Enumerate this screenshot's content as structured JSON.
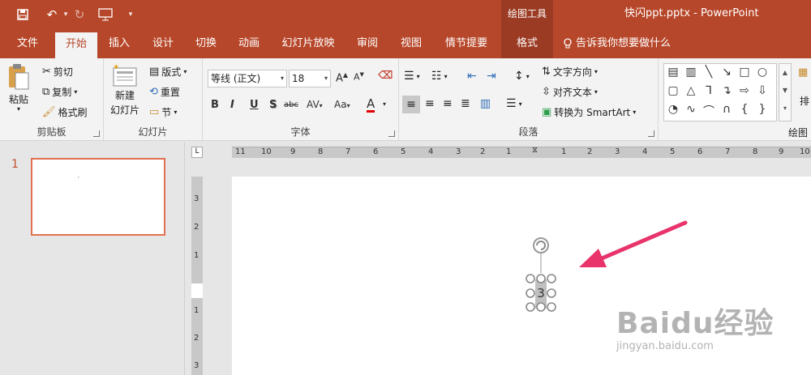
{
  "titlebar": {
    "context_tools": "绘图工具",
    "document_title": "快闪ppt.pptx  -  PowerPoint"
  },
  "tabs": [
    {
      "label": "文件"
    },
    {
      "label": "开始"
    },
    {
      "label": "插入"
    },
    {
      "label": "设计"
    },
    {
      "label": "切换"
    },
    {
      "label": "动画"
    },
    {
      "label": "幻灯片放映"
    },
    {
      "label": "审阅"
    },
    {
      "label": "视图"
    },
    {
      "label": "情节提要"
    },
    {
      "label": "格式"
    }
  ],
  "tell_me": "告诉我你想要做什么",
  "ribbon": {
    "clipboard": {
      "label": "剪贴板",
      "paste": "粘贴",
      "cut": "剪切",
      "copy": "复制",
      "format_painter": "格式刷"
    },
    "slides": {
      "label": "幻灯片",
      "new_slide_1": "新建",
      "new_slide_2": "幻灯片",
      "layout": "版式",
      "reset": "重置",
      "section": "节"
    },
    "font": {
      "label": "字体",
      "font_name": "等线 (正文)",
      "font_size": "18",
      "bold": "B",
      "italic": "I",
      "underline": "U",
      "shadow": "S",
      "strike": "abc",
      "spacing": "AV",
      "case": "Aa",
      "color": "A",
      "grow": "A",
      "shrink": "A"
    },
    "paragraph": {
      "label": "段落",
      "text_direction": "文字方向",
      "align_text": "对齐文本",
      "smartart": "转换为 SmartArt"
    },
    "drawing": {
      "label": "绘图",
      "arrange": "排"
    }
  },
  "slide_pane": {
    "slide_number": "1"
  },
  "ruler": {
    "corner": "L",
    "h_ticks": [
      "11",
      "10",
      "9",
      "8",
      "7",
      "6",
      "5",
      "4",
      "3",
      "2",
      "1",
      "1",
      "2",
      "3",
      "4",
      "5",
      "6",
      "7",
      "8",
      "9",
      "10"
    ],
    "v_ticks": [
      "3",
      "2",
      "1",
      "1",
      "2",
      "3"
    ]
  },
  "canvas": {
    "textbox_text": "3"
  },
  "watermark": {
    "logo": "Baidu经验",
    "url": "jingyan.baidu.com"
  },
  "colors": {
    "accent": "#b7472a",
    "context": "#9c3b23",
    "arrow": "#e8336b"
  }
}
